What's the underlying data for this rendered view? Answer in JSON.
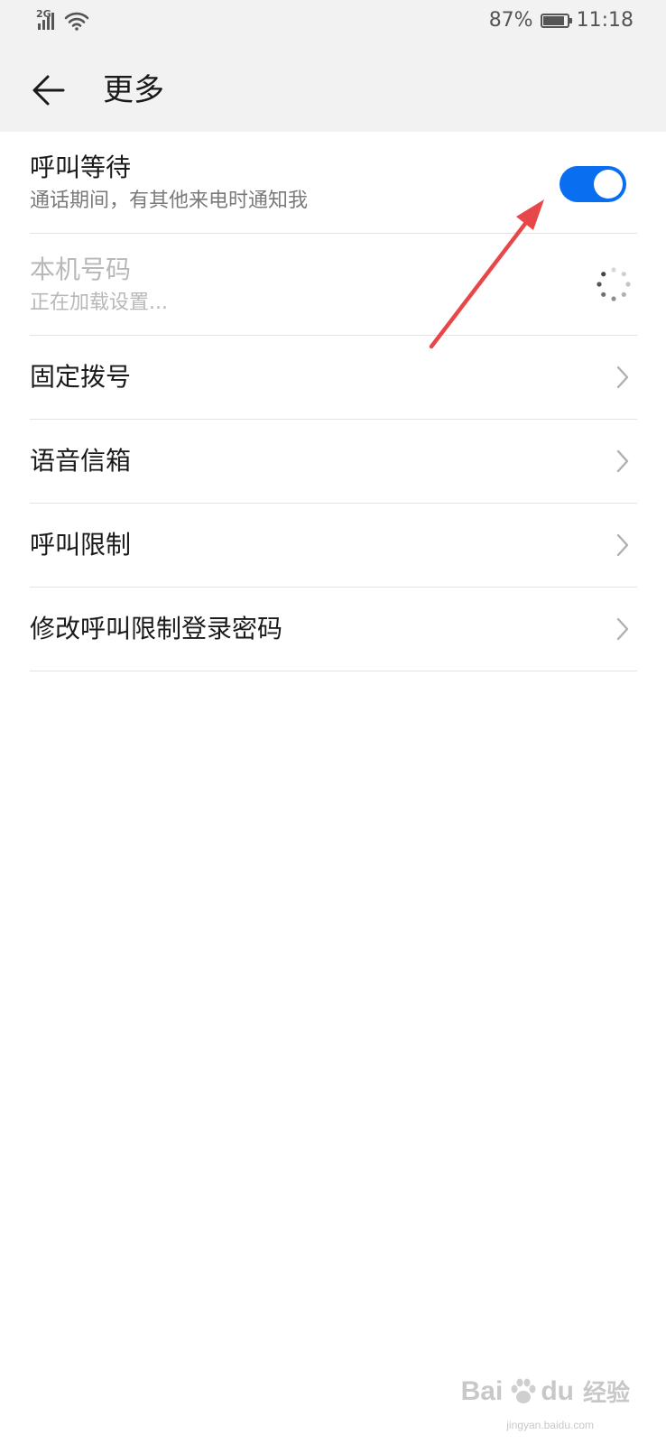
{
  "status_bar": {
    "network_type": "2G",
    "battery_percent_text": "87%",
    "battery_level": 0.87,
    "time": "11:18"
  },
  "toolbar": {
    "back_icon": "arrow-left-icon",
    "title": "更多"
  },
  "settings": {
    "call_waiting": {
      "title": "呼叫等待",
      "subtitle": "通话期间，有其他来电时通知我",
      "enabled": true,
      "toggle_color": "#0a6ef0"
    },
    "my_number": {
      "title": "本机号码",
      "subtitle": "正在加载设置..."
    },
    "items": [
      {
        "label": "固定拨号"
      },
      {
        "label": "语音信箱"
      },
      {
        "label": "呼叫限制"
      },
      {
        "label": "修改呼叫限制登录密码"
      }
    ]
  },
  "annotation": {
    "arrow_color": "#e8474a"
  },
  "watermark": {
    "brand": "Bai",
    "brand_suffix": "du",
    "product": "经验",
    "url": "jingyan.baidu.com"
  }
}
